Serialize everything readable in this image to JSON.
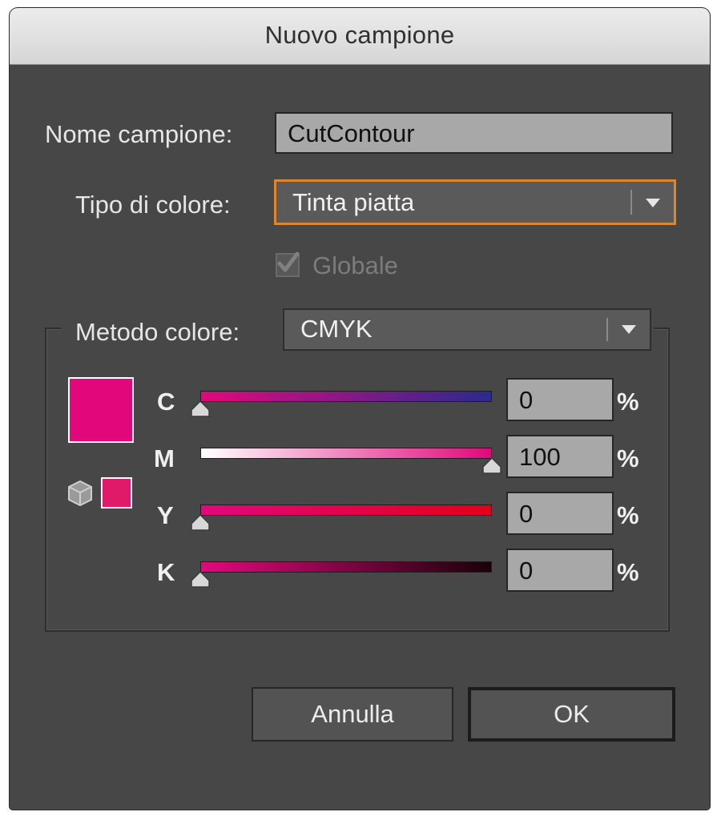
{
  "dialog": {
    "title": "Nuovo campione"
  },
  "name_field": {
    "label": "Nome campione:",
    "value": "CutContour"
  },
  "color_type": {
    "label": "Tipo di colore:",
    "value": "Tinta piatta"
  },
  "global_checkbox": {
    "label": "Globale",
    "checked": true,
    "enabled": false
  },
  "color_mode": {
    "label": "Metodo colore:",
    "value": "CMYK"
  },
  "preview": {
    "color": "#e2087c",
    "gamut_color": "#e01a68"
  },
  "channels": [
    {
      "name": "C",
      "value": "0",
      "unit": "%",
      "fraction": 0.0,
      "gradient": [
        "#e2087c",
        "#2b2a8c"
      ]
    },
    {
      "name": "M",
      "value": "100",
      "unit": "%",
      "fraction": 1.0,
      "gradient": [
        "#ffffff",
        "#e2087c"
      ]
    },
    {
      "name": "Y",
      "value": "0",
      "unit": "%",
      "fraction": 0.0,
      "gradient": [
        "#e2087c",
        "#e2001a"
      ]
    },
    {
      "name": "K",
      "value": "0",
      "unit": "%",
      "fraction": 0.0,
      "gradient": [
        "#e2087c",
        "#1a0008"
      ]
    }
  ],
  "buttons": {
    "cancel": "Annulla",
    "ok": "OK"
  },
  "colors": {
    "focus_ring": "#e0862a",
    "dialog_bg": "#474747"
  }
}
